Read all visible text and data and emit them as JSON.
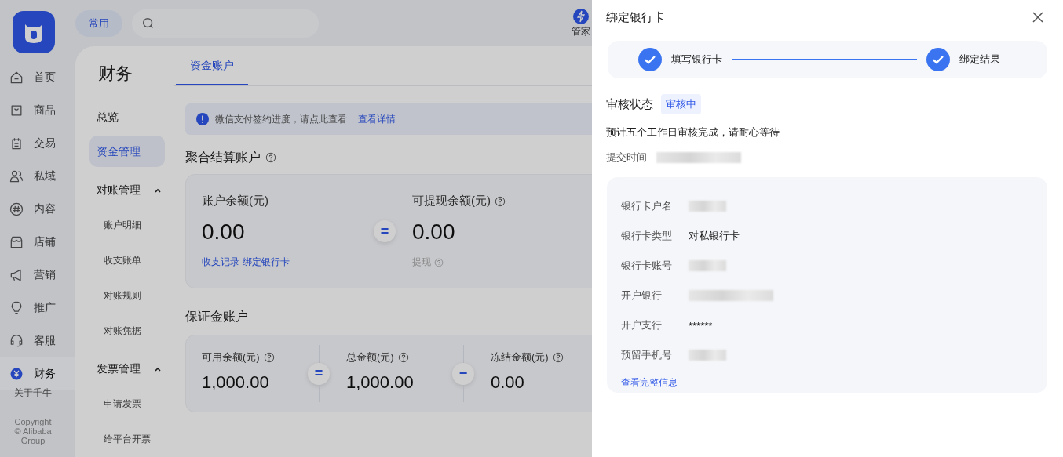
{
  "sidebar": {
    "items": [
      {
        "label": "首页",
        "selected": false
      },
      {
        "label": "商品",
        "selected": false
      },
      {
        "label": "交易",
        "selected": false
      },
      {
        "label": "私域",
        "selected": false
      },
      {
        "label": "内容",
        "selected": false
      },
      {
        "label": "店铺",
        "selected": false
      },
      {
        "label": "营销",
        "selected": false
      },
      {
        "label": "推广",
        "selected": false
      },
      {
        "label": "客服",
        "selected": false
      },
      {
        "label": "财务",
        "selected": true
      }
    ],
    "about": "关于千牛",
    "copyright": "Copyright",
    "company": "© Alibaba Group"
  },
  "topbar": {
    "pill": "常用",
    "assistant": "管家"
  },
  "finance": {
    "title": "财务",
    "nav": [
      {
        "label": "总览",
        "selected": false
      },
      {
        "label": "资金管理",
        "selected": true
      },
      {
        "label": "对账管理",
        "expanded": true,
        "children": [
          {
            "label": "账户明细",
            "selected": false
          },
          {
            "label": "收支账单",
            "selected": false
          },
          {
            "label": "对账规则",
            "selected": false
          },
          {
            "label": "对账凭据",
            "selected": false
          }
        ]
      },
      {
        "label": "发票管理",
        "expanded": true,
        "children": [
          {
            "label": "申请发票",
            "selected": false
          },
          {
            "label": "给平台开票",
            "selected": false
          }
        ]
      }
    ]
  },
  "tabs": [
    {
      "label": "资金账户",
      "selected": true
    }
  ],
  "alert": {
    "text": "微信支付签约进度，请点此查看",
    "link": "查看详情"
  },
  "settlement": {
    "title": "聚合结算账户",
    "items": [
      {
        "kind": "metric",
        "label": "账户余额(元)",
        "help": false,
        "value": "0.00",
        "links": [
          "收支记录",
          "绑定银行卡"
        ]
      },
      {
        "kind": "operator",
        "symbol": "="
      },
      {
        "kind": "metric",
        "label": "可提现余额(元)",
        "help": true,
        "value": "0.00",
        "action": {
          "label": "提现",
          "disabled": true
        }
      }
    ]
  },
  "deposit": {
    "title": "保证金账户",
    "items": [
      {
        "kind": "metric",
        "label": "可用余额(元)",
        "help": true,
        "value": "1,000.00"
      },
      {
        "kind": "operator",
        "symbol": "="
      },
      {
        "kind": "metric",
        "label": "总金额(元)",
        "help": true,
        "value": "1,000.00"
      },
      {
        "kind": "operator",
        "symbol": "−"
      },
      {
        "kind": "metric",
        "label": "冻结金额(元)",
        "help": true,
        "value": "0.00"
      }
    ]
  },
  "drawer": {
    "title": "绑定银行卡",
    "steps": [
      {
        "label": "填写银行卡",
        "done": true
      },
      {
        "label": "绑定结果",
        "done": true
      }
    ],
    "status": {
      "label": "审核状态",
      "tag": "审核中"
    },
    "note": "预计五个工作日审核完成，请耐心等待",
    "submit": {
      "label": "提交时间",
      "masked": true
    },
    "details": [
      {
        "label": "银行卡户名",
        "masked": true
      },
      {
        "label": "银行卡类型",
        "value": "对私银行卡",
        "masked": false
      },
      {
        "label": "银行卡账号",
        "masked": true
      },
      {
        "label": "开户银行",
        "masked": true
      },
      {
        "label": "开户支行",
        "value": "******",
        "masked": false
      },
      {
        "label": "预留手机号",
        "masked": true
      }
    ],
    "link": "查看完整信息"
  }
}
